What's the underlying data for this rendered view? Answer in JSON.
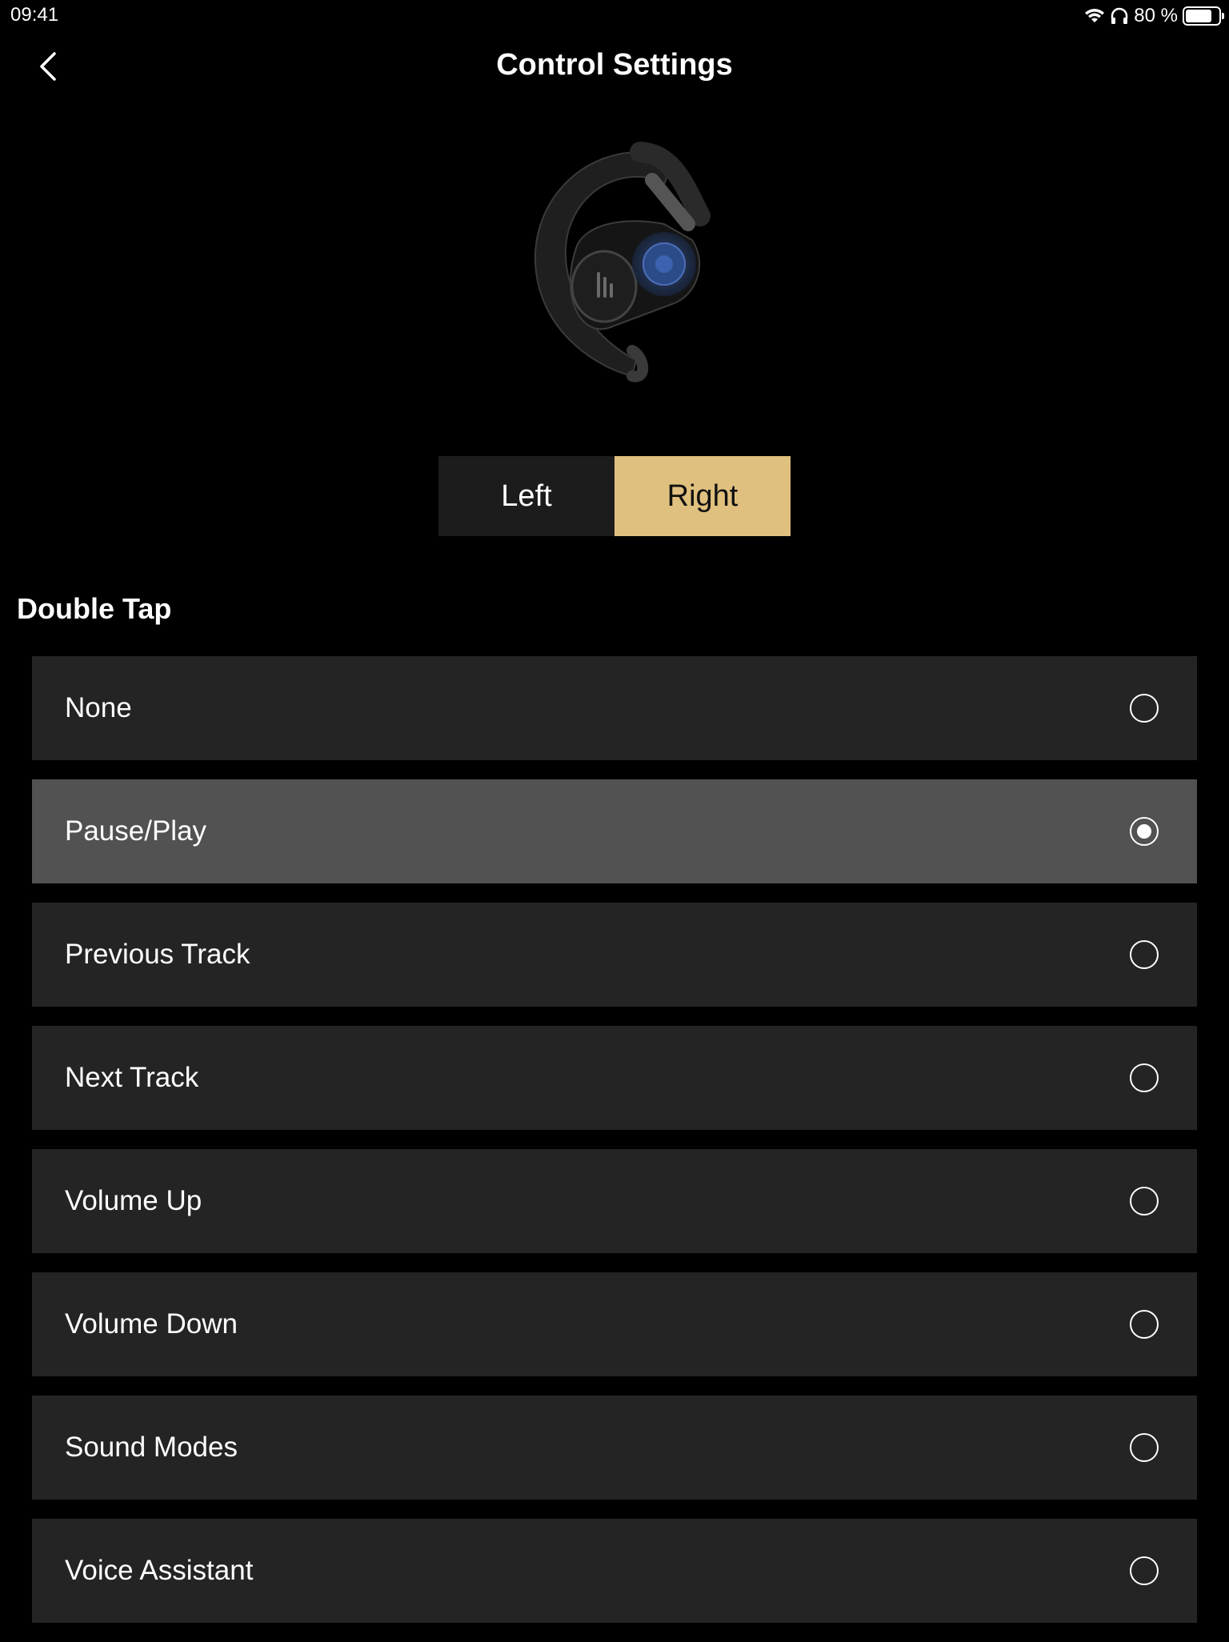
{
  "status": {
    "time": "09:41",
    "battery_text": "80 %",
    "battery_level": 0.8,
    "icons": [
      "wifi-icon",
      "headphones-icon",
      "battery-icon"
    ]
  },
  "header": {
    "title": "Control Settings",
    "back_icon": "chevron-left-icon"
  },
  "device": {
    "image": "earbud-right-image"
  },
  "segment": {
    "left_label": "Left",
    "right_label": "Right",
    "selected": "Right",
    "accent": "#E0C07E"
  },
  "section": {
    "title": "Double Tap"
  },
  "options": [
    {
      "label": "None",
      "selected": false
    },
    {
      "label": "Pause/Play",
      "selected": true
    },
    {
      "label": "Previous Track",
      "selected": false
    },
    {
      "label": "Next Track",
      "selected": false
    },
    {
      "label": "Volume Up",
      "selected": false
    },
    {
      "label": "Volume Down",
      "selected": false
    },
    {
      "label": "Sound Modes",
      "selected": false
    },
    {
      "label": "Voice Assistant",
      "selected": false
    }
  ]
}
